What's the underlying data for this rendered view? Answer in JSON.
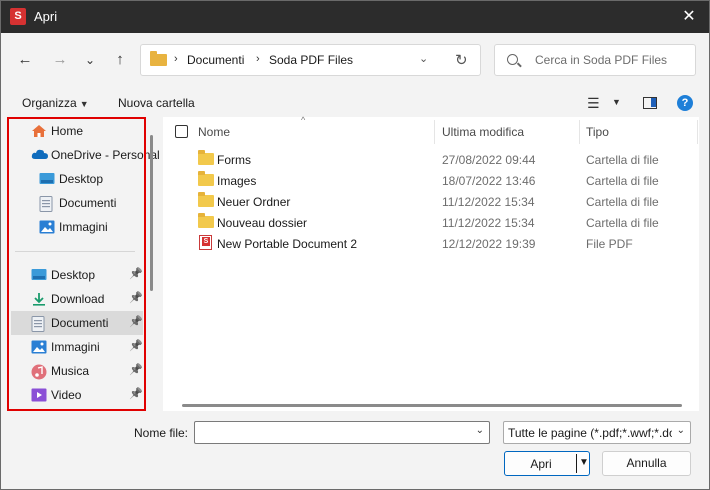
{
  "window": {
    "title": "Apri",
    "app_icon_letter": "S",
    "close_glyph": "✕"
  },
  "nav": {
    "back": "←",
    "forward": "→",
    "recent": "⌄",
    "up": "↑"
  },
  "address": {
    "crumbs": [
      "Documenti",
      "Soda PDF Files"
    ],
    "separator": "›",
    "refresh": "↻",
    "dropdown": "⌄"
  },
  "search": {
    "placeholder": "Cerca in Soda PDF Files"
  },
  "toolbar": {
    "organize": "Organizza",
    "new_folder": "Nuova cartella",
    "view_icon": "list-view-icon",
    "help": "?"
  },
  "sidebar": {
    "top": [
      {
        "label": "Home",
        "icon": "home-icon",
        "color": "#e8703a"
      },
      {
        "label": "OneDrive - Personal",
        "icon": "cloud-icon",
        "color": "#0f6cbd"
      },
      {
        "label": "Desktop",
        "icon": "desktop-icon",
        "color": "#3a9ad9"
      },
      {
        "label": "Documenti",
        "icon": "document-icon",
        "color": "#8a96a8"
      },
      {
        "label": "Immagini",
        "icon": "image-icon",
        "color": "#2a7fd4"
      }
    ],
    "pinned": [
      {
        "label": "Desktop",
        "icon": "desktop-icon",
        "color": "#3a9ad9"
      },
      {
        "label": "Download",
        "icon": "download-icon",
        "color": "#1a9b6c"
      },
      {
        "label": "Documenti",
        "icon": "document-icon",
        "color": "#8a96a8",
        "selected": true
      },
      {
        "label": "Immagini",
        "icon": "image-icon",
        "color": "#2a7fd4"
      },
      {
        "label": "Musica",
        "icon": "music-icon",
        "color": "#e0707a"
      },
      {
        "label": "Video",
        "icon": "video-icon",
        "color": "#8a4fd6"
      }
    ]
  },
  "columns": {
    "name": "Nome",
    "modified": "Ultima modifica",
    "type": "Tipo"
  },
  "files": [
    {
      "name": "Forms",
      "modified": "27/08/2022 09:44",
      "type": "Cartella di file",
      "kind": "folder"
    },
    {
      "name": "Images",
      "modified": "18/07/2022 13:46",
      "type": "Cartella di file",
      "kind": "folder"
    },
    {
      "name": "Neuer Ordner",
      "modified": "11/12/2022 15:34",
      "type": "Cartella di file",
      "kind": "folder"
    },
    {
      "name": "Nouveau dossier",
      "modified": "11/12/2022 15:34",
      "type": "Cartella di file",
      "kind": "folder"
    },
    {
      "name": "New Portable Document 2",
      "modified": "12/12/2022 19:39",
      "type": "File PDF",
      "kind": "pdf"
    }
  ],
  "bottom": {
    "filename_label": "Nome file:",
    "filename_value": "",
    "filter_value": "Tutte le pagine (*.pdf;*.wwf;*.doc",
    "open_label": "Apri",
    "cancel_label": "Annulla"
  },
  "colors": {
    "highlight_frame": "#e00000",
    "accent": "#0067c0"
  }
}
